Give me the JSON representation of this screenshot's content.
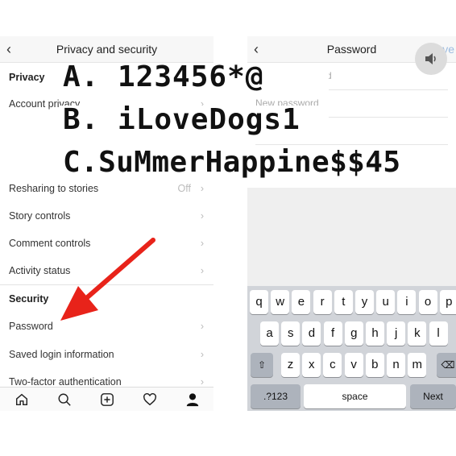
{
  "left": {
    "title": "Privacy and security",
    "rows": [
      {
        "label": "Privacy",
        "section": true
      },
      {
        "label": "Account privacy"
      },
      {
        "label": "Resharing to stories",
        "value": "Off"
      },
      {
        "label": "Story controls"
      },
      {
        "label": "Comment controls"
      },
      {
        "label": "Activity status"
      },
      {
        "label": "Security",
        "section": true
      },
      {
        "label": "Password"
      },
      {
        "label": "Saved login information"
      },
      {
        "label": "Two-factor authentication"
      }
    ],
    "tabs": [
      "home-icon",
      "search-icon",
      "add-post-icon",
      "heart-icon",
      "profile-icon"
    ]
  },
  "right": {
    "title": "Password",
    "save": "Save",
    "fields": [
      "Current password",
      "New password"
    ],
    "keyboard": {
      "row1": [
        "q",
        "w",
        "e",
        "r",
        "t",
        "y",
        "u",
        "i",
        "o",
        "p"
      ],
      "row2": [
        "a",
        "s",
        "d",
        "f",
        "g",
        "h",
        "j",
        "k",
        "l"
      ],
      "row3": [
        "z",
        "x",
        "c",
        "v",
        "b",
        "n",
        "m"
      ],
      "numbers": ".?123",
      "space": "space",
      "next": "Next"
    }
  },
  "overlay": [
    "A. 123456*@",
    "B. iLoveDogs1",
    "C.SuMmerHappine$$45"
  ],
  "colors": {
    "arrow": "#e8231a",
    "keyboard": "#d1d4d9"
  }
}
